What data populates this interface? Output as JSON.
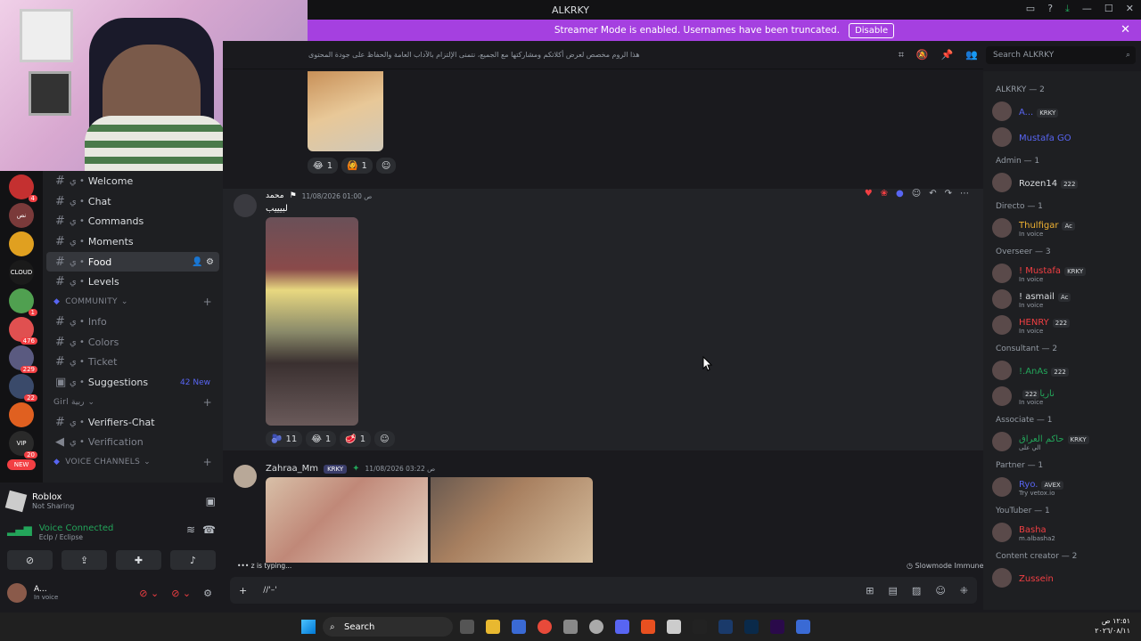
{
  "window": {
    "title": "ALKRKY"
  },
  "banner": {
    "text": "Streamer Mode is enabled. Usernames have been truncated.",
    "button": "Disable"
  },
  "topic": {
    "text": "هذا الروم مخصص لعرض أكلاتكم ومشاركتها مع الجميع، نتمنى الإلتزام بالآداب العامة والحفاظ على جودة المحتوى"
  },
  "search": {
    "placeholder": "Search ALKRKY"
  },
  "servers": {
    "badges": [
      "4",
      "1",
      "476",
      "229",
      "22",
      "20"
    ],
    "new_label": "NEW"
  },
  "channels": {
    "items": [
      {
        "label": "Welcome"
      },
      {
        "label": "Chat"
      },
      {
        "label": "Commands"
      },
      {
        "label": "Moments"
      },
      {
        "label": "Food"
      },
      {
        "label": "Levels"
      }
    ],
    "community_label": "COMMUNITY",
    "community_items": [
      {
        "label": "Info"
      },
      {
        "label": "Colors"
      },
      {
        "label": "Ticket"
      },
      {
        "label": "Suggestions",
        "badge": "42 New"
      }
    ],
    "girl_label": "Girl ربية",
    "girl_items": [
      {
        "label": "Verifiers-Chat"
      },
      {
        "label": "Verification"
      }
    ],
    "voice_label": "VOICE CHANNELS"
  },
  "activity": {
    "title": "Roblox",
    "subtitle": "Not Sharing"
  },
  "voice": {
    "status": "Voice Connected",
    "server": "Eclp / Eclipse"
  },
  "me": {
    "name": "A...",
    "status": "In voice"
  },
  "reactions_top": [
    {
      "emoji": "😂",
      "count": "1"
    },
    {
      "emoji": "🙆",
      "count": "1"
    }
  ],
  "message1": {
    "author": "محمد",
    "time": "11/08/2026 01:00 ص",
    "text": "لبيييب",
    "reactions": [
      {
        "emoji": "🫐",
        "count": "11"
      },
      {
        "emoji": "😂",
        "count": "1"
      },
      {
        "emoji": "🥩",
        "count": "1"
      }
    ]
  },
  "message2": {
    "author": "Zahraa_Mm",
    "tag": "KRKY",
    "time": "11/08/2026 03:22 ص"
  },
  "typing": {
    "text": "z is typing..."
  },
  "slowmode": {
    "text": "Slowmode Immune"
  },
  "composer": {
    "value": "//'–'"
  },
  "members": {
    "groups": [
      {
        "role": "ALKRKY — 2",
        "items": [
          {
            "name": "A...",
            "tag": "KRKY",
            "color": "#5865f2",
            "sub": ""
          },
          {
            "name": "Mustafa GO",
            "tag": "",
            "color": "#5865f2",
            "sub": ""
          }
        ]
      },
      {
        "role": "Admin — 1",
        "items": [
          {
            "name": "Rozen14",
            "tag": "222",
            "color": "#dbdee1",
            "sub": ""
          }
        ]
      },
      {
        "role": "Directo — 1",
        "items": [
          {
            "name": "Thulfigar",
            "tag": "Ac",
            "color": "#f0b232",
            "sub": "In voice"
          }
        ]
      },
      {
        "role": "Overseer — 3",
        "items": [
          {
            "name": "! Mustafa",
            "tag": "KRKY",
            "color": "#f23f43",
            "sub": "In voice"
          },
          {
            "name": "! asmail",
            "tag": "Ac",
            "color": "#dbdee1",
            "sub": "In voice"
          },
          {
            "name": "HENRY",
            "tag": "222",
            "color": "#f23f43",
            "sub": "In voice"
          }
        ]
      },
      {
        "role": "Consultant — 2",
        "items": [
          {
            "name": "!.AnAs",
            "tag": "222",
            "color": "#23a55a",
            "sub": ""
          },
          {
            "name": "ناريا",
            "tag": "222",
            "color": "#23a55a",
            "sub": "In voice"
          }
        ]
      },
      {
        "role": "Associate — 1",
        "items": [
          {
            "name": "حاكم العراق",
            "tag": "KRKY",
            "color": "#23a55a",
            "sub": "الي على"
          }
        ]
      },
      {
        "role": "Partner — 1",
        "items": [
          {
            "name": "Ryo.",
            "tag": "AVEX",
            "color": "#5865f2",
            "sub": "Try vetox.io"
          }
        ]
      },
      {
        "role": "YouTuber — 1",
        "items": [
          {
            "name": "Basha",
            "tag": "",
            "color": "#f23f43",
            "sub": "m.albasha2"
          }
        ]
      },
      {
        "role": "Content creator — 2",
        "items": [
          {
            "name": "Zussein",
            "tag": "",
            "color": "#f23f43",
            "sub": ""
          }
        ]
      }
    ]
  },
  "taskbar": {
    "search_label": "Search",
    "time": "١٢:٥١ ص",
    "date": "٢٠٢٦/٠٨/١١"
  }
}
